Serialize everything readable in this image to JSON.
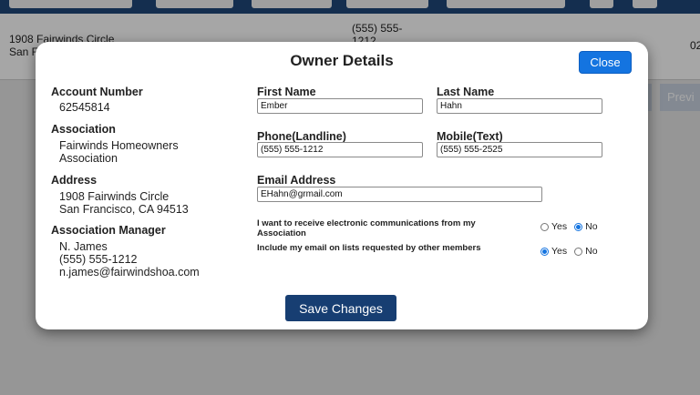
{
  "background": {
    "row": {
      "address_line1": "1908 Fairwinds Circle",
      "address_line2": "San F",
      "phone_line1": "(555) 555-",
      "phone_line2": "1212",
      "trailing": "02"
    },
    "pager": {
      "prev_label": "Previ"
    }
  },
  "modal": {
    "title": "Owner Details",
    "close_label": "Close",
    "account": {
      "label": "Account Number",
      "value": "62545814"
    },
    "association": {
      "label": "Association",
      "line1": "Fairwinds Homeowners",
      "line2": "Association"
    },
    "address": {
      "label": "Address",
      "line1": "1908 Fairwinds Circle",
      "line2": "San Francisco, CA 94513"
    },
    "manager": {
      "label": "Association Manager",
      "name": "N. James",
      "phone": "(555) 555-1212",
      "email": "n.james@fairwindshoa.com"
    },
    "first_name": {
      "label": "First Name",
      "value": "Ember"
    },
    "last_name": {
      "label": "Last Name",
      "value": "Hahn"
    },
    "phone_landline": {
      "label": "Phone(Landline)",
      "value": "(555) 555-1212"
    },
    "mobile": {
      "label": "Mobile(Text)",
      "value": "(555) 555-2525"
    },
    "email": {
      "label": "Email Address",
      "value": "EHahn@grmail.com"
    },
    "pref_electronic": {
      "text_line1": "I want to receive electronic communications from my",
      "text_line2": "Association",
      "yes_label": "Yes",
      "no_label": "No",
      "selected": "No"
    },
    "pref_email_list": {
      "text": "Include my email on lists requested by other members",
      "yes_label": "Yes",
      "no_label": "No",
      "selected": "Yes"
    },
    "save_label": "Save Changes"
  },
  "colors": {
    "header": "#20477a",
    "close_button": "#1474e0",
    "save_button": "#173e72",
    "radio_selected": "#1474e0"
  }
}
